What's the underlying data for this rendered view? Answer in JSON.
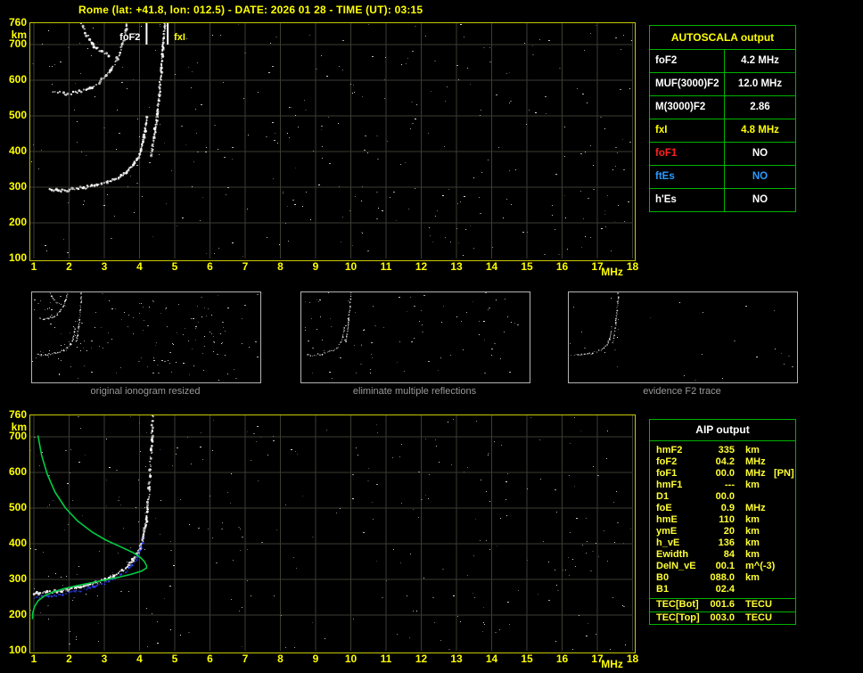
{
  "title": "Rome (lat: +41.8, lon: 012.5) - DATE: 2026 01 28 - TIME (UT): 03:15",
  "colors": {
    "yellow": "#ffff00",
    "white": "#ffffff",
    "red": "#ff2222",
    "blue": "#2b9bff",
    "plot_border": "#c8c800",
    "table_border": "#00b400",
    "grid": "#3c3c34",
    "trace": "#ffffff",
    "profile_green": "#00cc44",
    "restored_blue": "#3344ff",
    "caption": "#999999",
    "aip_text": "#ffff33"
  },
  "axes": {
    "x_labels": [
      "1",
      "2",
      "3",
      "4",
      "5",
      "6",
      "7",
      "8",
      "9",
      "10",
      "11",
      "12",
      "13",
      "14",
      "15",
      "16",
      "17",
      "18"
    ],
    "x_unit": "MHz",
    "y_labels": [
      "760",
      "700",
      "600",
      "500",
      "400",
      "300",
      "200",
      "100"
    ],
    "y_unit": "km",
    "x_range": [
      1,
      18
    ],
    "y_range": [
      100,
      760
    ]
  },
  "top_plot": {
    "markers": [
      {
        "label": "foF2",
        "freq": 4.2,
        "color": "white"
      },
      {
        "label": "fxI",
        "freq": 4.8,
        "color": "yellow"
      }
    ],
    "white_traces": [
      "f2_main",
      "f2_asym",
      "hop2a",
      "hop2b"
    ],
    "noise": 330
  },
  "bottom_plot": {
    "white_traces": [
      "f2_main_b",
      "f2_asym_b"
    ],
    "blue_trace": "blue_restored",
    "green_traces": [
      "green_topside",
      "green_bottomside"
    ],
    "noise": 300
  },
  "traces": {
    "f2_main": [
      [
        1.45,
        294
      ],
      [
        1.7,
        290
      ],
      [
        2.0,
        292
      ],
      [
        2.4,
        298
      ],
      [
        2.8,
        306
      ],
      [
        3.1,
        315
      ],
      [
        3.4,
        327
      ],
      [
        3.65,
        343
      ],
      [
        3.85,
        365
      ],
      [
        4.0,
        392
      ],
      [
        4.1,
        424
      ],
      [
        4.17,
        460
      ],
      [
        4.22,
        498
      ]
    ],
    "f2_asym": [
      [
        4.33,
        390
      ],
      [
        4.42,
        440
      ],
      [
        4.5,
        500
      ],
      [
        4.56,
        560
      ],
      [
        4.62,
        625
      ],
      [
        4.67,
        690
      ],
      [
        4.72,
        760
      ]
    ],
    "hop2a": [
      [
        1.55,
        570
      ],
      [
        1.9,
        562
      ],
      [
        2.25,
        566
      ],
      [
        2.6,
        578
      ],
      [
        2.9,
        598
      ],
      [
        3.15,
        625
      ],
      [
        3.38,
        662
      ],
      [
        3.55,
        708
      ],
      [
        3.65,
        760
      ]
    ],
    "hop2b": [
      [
        2.35,
        760
      ],
      [
        2.5,
        728
      ],
      [
        2.68,
        700
      ],
      [
        2.9,
        680
      ],
      [
        3.15,
        670
      ]
    ],
    "f2_main_b": [
      [
        1.0,
        262
      ],
      [
        1.4,
        264
      ],
      [
        1.8,
        268
      ],
      [
        2.2,
        276
      ],
      [
        2.6,
        286
      ],
      [
        3.0,
        298
      ],
      [
        3.3,
        312
      ],
      [
        3.6,
        330
      ],
      [
        3.82,
        354
      ],
      [
        4.0,
        384
      ],
      [
        4.1,
        416
      ],
      [
        4.18,
        452
      ],
      [
        4.24,
        500
      ]
    ],
    "f2_asym_b": [
      [
        4.24,
        500
      ],
      [
        4.28,
        555
      ],
      [
        4.31,
        610
      ],
      [
        4.34,
        665
      ],
      [
        4.36,
        715
      ],
      [
        4.38,
        760
      ]
    ],
    "blue_restored": [
      [
        1.0,
        250
      ],
      [
        1.4,
        253
      ],
      [
        1.8,
        258
      ],
      [
        2.2,
        266
      ],
      [
        2.6,
        276
      ],
      [
        3.0,
        289
      ],
      [
        3.3,
        302
      ],
      [
        3.6,
        320
      ],
      [
        3.8,
        340
      ],
      [
        3.95,
        362
      ],
      [
        4.05,
        388
      ],
      [
        4.12,
        418
      ]
    ],
    "green_topside": [
      [
        1.12,
        702
      ],
      [
        1.22,
        648
      ],
      [
        1.38,
        595
      ],
      [
        1.6,
        545
      ],
      [
        1.9,
        500
      ],
      [
        2.25,
        463
      ],
      [
        2.65,
        433
      ],
      [
        3.05,
        410
      ],
      [
        3.45,
        392
      ],
      [
        3.8,
        376
      ],
      [
        4.02,
        362
      ],
      [
        4.14,
        350
      ],
      [
        4.2,
        338
      ]
    ],
    "green_bottomside": [
      [
        4.2,
        332
      ],
      [
        4.05,
        323
      ],
      [
        3.75,
        314
      ],
      [
        3.4,
        306
      ],
      [
        3.0,
        298
      ],
      [
        2.6,
        290
      ],
      [
        2.2,
        282
      ],
      [
        1.85,
        274
      ],
      [
        1.55,
        265
      ],
      [
        1.3,
        254
      ],
      [
        1.12,
        240
      ],
      [
        1.02,
        224
      ],
      [
        0.97,
        207
      ],
      [
        0.96,
        190
      ]
    ]
  },
  "thumbnails": [
    {
      "caption": "original ionogram resized",
      "trace_keys": [
        "f2_main",
        "f2_asym",
        "hop2a",
        "hop2b"
      ],
      "noise": 160
    },
    {
      "caption": "eliminate multiple reflections",
      "trace_keys": [
        "f2_main",
        "f2_asym"
      ],
      "noise": 85
    },
    {
      "caption": "evidence F2 trace",
      "trace_keys": [
        "f2_main",
        "f2_asym"
      ],
      "noise": 28
    }
  ],
  "autoscala_table": {
    "header": "AUTOSCALA output",
    "rows": [
      {
        "label": "foF2",
        "value": "4.2 MHz",
        "label_color": "white",
        "value_color": "white"
      },
      {
        "label": "MUF(3000)F2",
        "value": "12.0 MHz",
        "label_color": "white",
        "value_color": "white"
      },
      {
        "label": "M(3000)F2",
        "value": "2.86",
        "label_color": "white",
        "value_color": "white"
      },
      {
        "label": "fxI",
        "value": "4.8 MHz",
        "label_color": "yellow",
        "value_color": "yellow"
      },
      {
        "label": "foF1",
        "value": "NO",
        "label_color": "red",
        "value_color": "white"
      },
      {
        "label": "ftEs",
        "value": "NO",
        "label_color": "blue",
        "value_color": "blue"
      },
      {
        "label": "h'Es",
        "value": "NO",
        "label_color": "white",
        "value_color": "white"
      }
    ]
  },
  "aip_table": {
    "header": "AIP output",
    "rows": [
      {
        "name": "hmF2",
        "value": "335",
        "unit": "km",
        "extra": ""
      },
      {
        "name": "foF2",
        "value": "04.2",
        "unit": "MHz",
        "extra": ""
      },
      {
        "name": "foF1",
        "value": "00.0",
        "unit": "MHz",
        "extra": "[PN]"
      },
      {
        "name": "hmF1",
        "value": "---",
        "unit": "km",
        "extra": ""
      },
      {
        "name": "D1",
        "value": "00.0",
        "unit": "",
        "extra": ""
      },
      {
        "name": "foE",
        "value": "0.9",
        "unit": "MHz",
        "extra": ""
      },
      {
        "name": "hmE",
        "value": "110",
        "unit": "km",
        "extra": ""
      },
      {
        "name": "ymE",
        "value": "20",
        "unit": "km",
        "extra": ""
      },
      {
        "name": "h_vE",
        "value": "136",
        "unit": "km",
        "extra": ""
      },
      {
        "name": "Ewidth",
        "value": "84",
        "unit": "km",
        "extra": ""
      },
      {
        "name": "DelN_vE",
        "value": "00.1",
        "unit": "m^(-3)",
        "extra": ""
      },
      {
        "name": "B0",
        "value": "088.0",
        "unit": "km",
        "extra": ""
      },
      {
        "name": "B1",
        "value": "02.4",
        "unit": "",
        "extra": ""
      }
    ],
    "tec_rows": [
      {
        "name": "TEC[Bot]",
        "value": "001.6",
        "unit": "TECU"
      },
      {
        "name": "TEC[Top]",
        "value": "003.0",
        "unit": "TECU"
      }
    ]
  }
}
